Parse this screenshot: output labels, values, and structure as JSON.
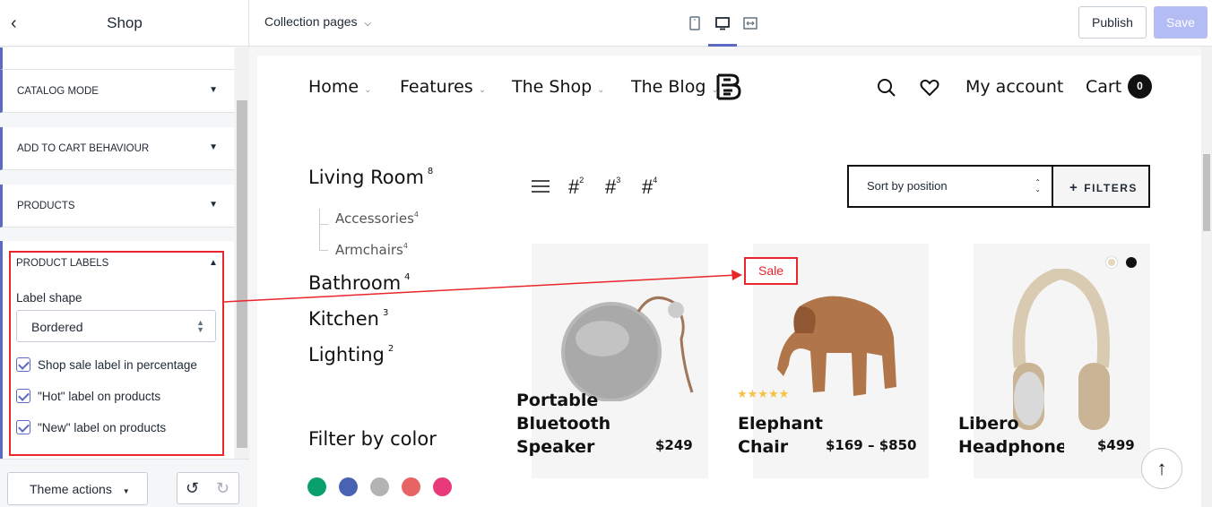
{
  "header": {
    "shop_title": "Shop",
    "page_select": "Collection pages",
    "publish_label": "Publish",
    "save_label": "Save"
  },
  "sidebar": {
    "sections": [
      {
        "label": "CATALOG MODE"
      },
      {
        "label": "ADD TO CART BEHAVIOUR"
      },
      {
        "label": "PRODUCTS"
      },
      {
        "label": "PRODUCT LABELS"
      }
    ],
    "label_shape_label": "Label shape",
    "label_shape_value": "Bordered",
    "checkboxes": [
      {
        "label": "Shop sale label in percentage",
        "checked": true
      },
      {
        "label": "\"Hot\" label on products",
        "checked": true
      },
      {
        "label": "\"New\" label on products",
        "checked": true
      }
    ],
    "theme_actions_label": "Theme actions"
  },
  "preview": {
    "nav": [
      {
        "label": "Home"
      },
      {
        "label": "Features"
      },
      {
        "label": "The Shop"
      },
      {
        "label": "The Blog"
      }
    ],
    "my_account": "My account",
    "cart_label": "Cart",
    "cart_count": "0",
    "categories": [
      {
        "name": "Living Room",
        "count": "8"
      },
      {
        "name": "Bathroom",
        "count": "4"
      },
      {
        "name": "Kitchen",
        "count": "3"
      },
      {
        "name": "Lighting",
        "count": "2"
      }
    ],
    "subcategories": [
      {
        "name": "Accessories",
        "count": "4"
      },
      {
        "name": "Armchairs",
        "count": "4"
      }
    ],
    "grid_options": [
      {
        "count": "2"
      },
      {
        "count": "3"
      },
      {
        "count": "4"
      }
    ],
    "sort_value": "Sort by position",
    "filters_label": "FILTERS",
    "products": [
      {
        "name_lines": [
          "Portable",
          "Bluetooth",
          "Speaker"
        ],
        "price": "$249"
      },
      {
        "name_lines": [
          "Elephant",
          "Chair"
        ],
        "price": "$169 – $850",
        "badge": "Sale",
        "rating": 5
      },
      {
        "name_lines": [
          "Libero",
          "Headphones"
        ],
        "price": "$499"
      }
    ],
    "filter_by_color": "Filter by color",
    "colors": [
      "#0aa06e",
      "#4a62b3",
      "#b3b3b3",
      "#e86363",
      "#e83a7a"
    ]
  },
  "colors": {
    "accent": "#5c6ac4",
    "save_disabled": "#b3bcf5",
    "annotation_red": "#e8262b"
  }
}
